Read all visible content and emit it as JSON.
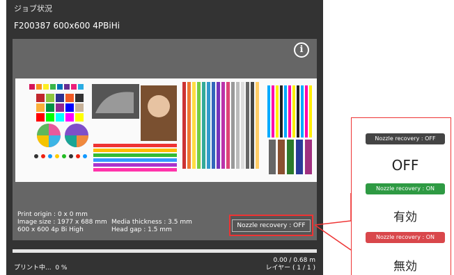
{
  "panel": {
    "title": "ジョブ状況",
    "job_name": "F200387 600x600 4PBiHi",
    "info_icon_glyph": "i"
  },
  "info": {
    "print_origin": "Print origin : 0 x 0 mm",
    "image_size": "Image size : 1977 x 688 mm",
    "mode": "600 x 600 4p Bi High",
    "media_thickness": "Media thickness : 3.5 mm",
    "head_gap": "Head gap : 1.5 mm"
  },
  "nozzle_button": {
    "label": "Nozzle recovery : OFF"
  },
  "status": {
    "printing": "プリント中...",
    "percent": "0 %",
    "progress_fraction": 0,
    "length": "0.00 / 0.68 m",
    "layer": "レイヤー ( 1 / 1 )"
  },
  "legend": [
    {
      "label": "Nozzle recovery : OFF",
      "meaning": "OFF",
      "color": "#444444"
    },
    {
      "label": "Nozzle recovery : ON",
      "meaning": "有効",
      "color": "#2e9a43"
    },
    {
      "label": "Nozzle recovery : ON",
      "meaning": "無効",
      "color": "#d9474b"
    }
  ],
  "colors": {
    "highlight": "#e33333",
    "panel_bg": "#333333"
  }
}
